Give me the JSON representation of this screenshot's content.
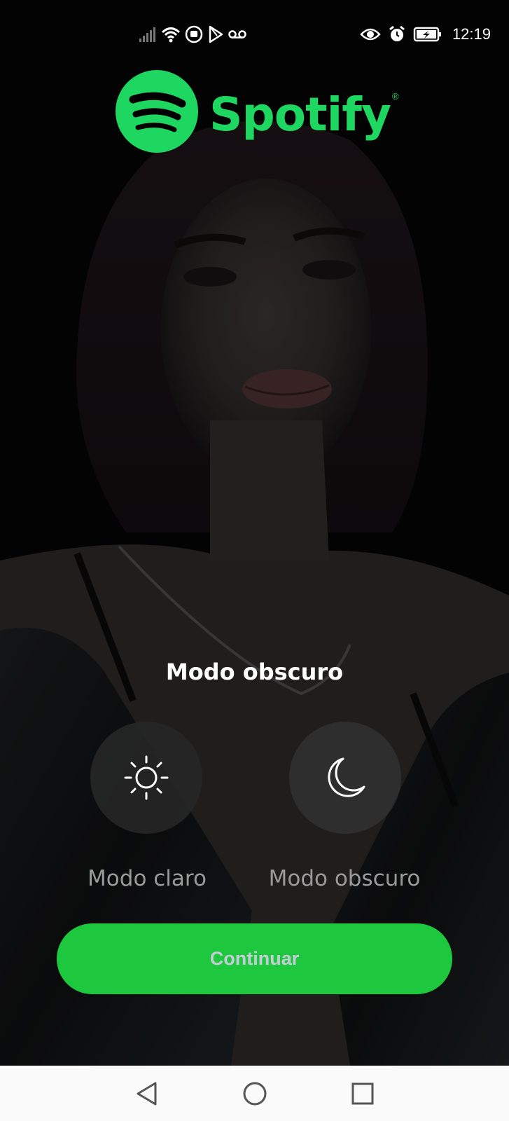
{
  "status_bar": {
    "time": "12:19",
    "icons_left": [
      "signal-icon",
      "wifi-icon",
      "app-notification-icon",
      "play-store-icon",
      "voicemail-icon"
    ],
    "icons_right": [
      "eye-icon",
      "alarm-icon",
      "battery-charging-icon"
    ]
  },
  "brand": {
    "name": "Spotify",
    "registered_mark": "®",
    "color": "#1ed760"
  },
  "theme_picker": {
    "title": "Modo obscuro",
    "options": [
      {
        "label": "Modo claro",
        "icon": "sun-icon"
      },
      {
        "label": "Modo obscuro",
        "icon": "moon-icon"
      }
    ]
  },
  "actions": {
    "continue_label": "Continuar",
    "continue_color": "#1ec83e"
  },
  "nav_bar": {
    "buttons": [
      "back-icon",
      "home-icon",
      "recents-icon"
    ]
  }
}
